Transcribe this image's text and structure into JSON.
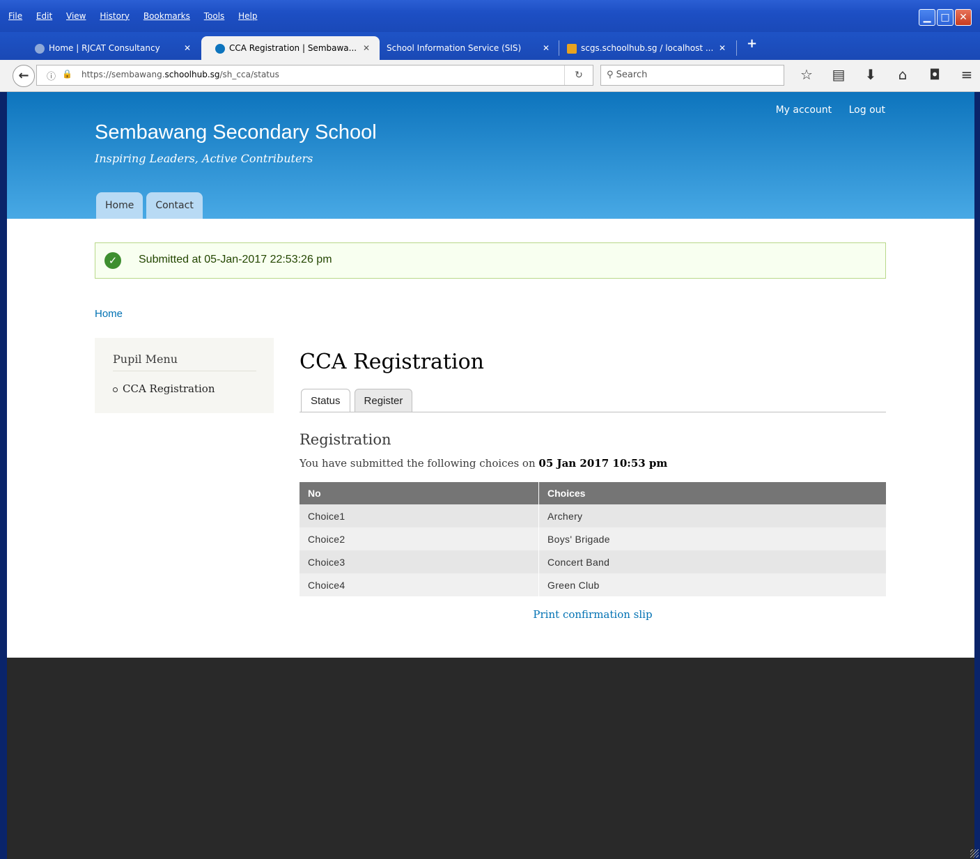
{
  "menubar": [
    "File",
    "Edit",
    "View",
    "History",
    "Bookmarks",
    "Tools",
    "Help"
  ],
  "tabs": [
    {
      "label": "Home | RJCAT Consultancy",
      "icon": "rj-icon",
      "active": false
    },
    {
      "label": "CCA Registration | Sembawa...",
      "icon": "drupal-icon",
      "active": true
    },
    {
      "label": "School Information Service (SIS)",
      "icon": "",
      "active": false
    },
    {
      "label": "scgs.schoolhub.sg / localhost ...",
      "icon": "pma-icon",
      "active": false
    }
  ],
  "newtab": "+",
  "close_glyph": "✕",
  "url": {
    "prefix": "https://sembawang.",
    "domain": "schoolhub.sg",
    "path": "/sh_cca/status"
  },
  "search": {
    "placeholder": "Search"
  },
  "toolbar_icons": [
    "bookmark-star-icon",
    "reading-list-icon",
    "download-icon",
    "home-icon",
    "pocket-icon",
    "menu-icon"
  ],
  "site": {
    "secondary_menu": [
      "My account",
      "Log out"
    ],
    "name": "Sembawang Secondary School",
    "slogan": "Inspiring Leaders, Active Contributers",
    "main_menu": [
      "Home",
      "Contact"
    ]
  },
  "message": "Submitted at 05-Jan-2017 22:53:26 pm",
  "breadcrumb": "Home",
  "sidebar": {
    "title": "Pupil Menu",
    "items": [
      "CCA Registration"
    ]
  },
  "page": {
    "title": "CCA Registration",
    "tabs": [
      "Status",
      "Register"
    ],
    "section_title": "Registration",
    "intro": "You have submitted the following choices on",
    "intro_date": "05 Jan 2017 10:53 pm",
    "table": {
      "headers": [
        "No",
        "Choices"
      ],
      "rows": [
        [
          "Choice1",
          "Archery"
        ],
        [
          "Choice2",
          "Boys' Brigade"
        ],
        [
          "Choice3",
          "Concert Band"
        ],
        [
          "Choice4",
          "Green Club"
        ]
      ]
    },
    "print_link": "Print confirmation slip"
  },
  "colors": {
    "header_top": "#0d74bd",
    "header_bottom": "#48a9e5",
    "link": "#0071b3",
    "success": "#3e8e2f",
    "footer": "#292929"
  }
}
